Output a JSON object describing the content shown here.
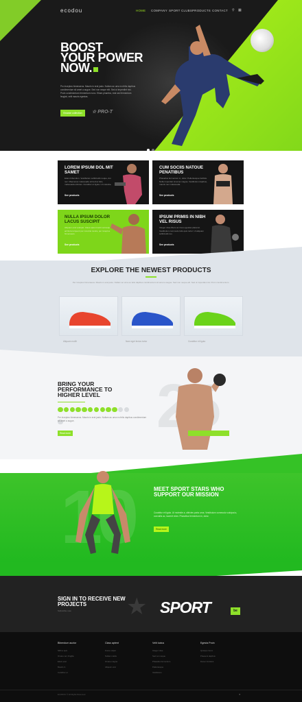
{
  "nav": {
    "logo": "ecodou",
    "items": [
      "HOME",
      "COMPANY",
      "SPORT CLUBS",
      "PRODUCTS",
      "CONTACT"
    ]
  },
  "hero": {
    "title_line1": "BOOST",
    "title_line2": "YOUR POWER",
    "title_line3": "NOW.",
    "text": "Pro inceptos himenaeos. Mauris in erat justo. Nullam ac urna eu felis dapibus condimentum sit amet a augue. Sed non neque elit. Sed ut imperdiet nisi. Proin condimentum fermentum nunc. Etiam pharetra, erat sed fermentum feugiat, velit mauris egestas.",
    "button": "Browse collection",
    "badge": "PRO-T"
  },
  "cards": [
    {
      "title": "LOREM IPSUM DOL MIT SAMET",
      "text": "Etiam bibendum. Vestibulum sollicitudin neque, dui nec. Maecenas malesuada elit lectus felis, malesuada ultricies. Curabitur et ligula. Ut molestie.",
      "link": "See products"
    },
    {
      "title": "CUM SOCIIS NATOUE PENATIBUS",
      "text": "Phasellus fermentum in, dolor. Pellentesque facilisis. Nulla imperdiet sit amet magna. Vestibulum dapibus, mauris nec malesuada.",
      "link": "See products"
    },
    {
      "title": "NULLA IPSUM DOLOR LACUS SUSCIPIT",
      "text": "Aliquam erat volutpat. Class aptent taciti sociosqu ad litora torquent per conubia nostra, per inceptos himenaeos.",
      "link": "See products"
    },
    {
      "title": "IPSUM PRIMIS IN NIBH VEL RISUS",
      "text": "Integer vitae libero ac risus egestas placerat. Vestibulum commodo felis quis tortor. Ut aliquam sollicitudin leo.",
      "link": "See products"
    }
  ],
  "products": {
    "title": "EXPLORE THE NEWEST PRODUCTS",
    "text": "Per inceptos himenaeos. Mauris in erat justo. Nullam ac urna eu felis dapibus condimentum sit amet a augue. Sed non neque elit. Sed ut imperdiet nisi. Proin condimentum.",
    "items": [
      {
        "label": "Aliquam mollit",
        "color": "#e8452e"
      },
      {
        "label": "Nam eget lectus tortor",
        "color": "#2a55c9"
      },
      {
        "label": "Curabitur et ligula",
        "color": "#6bd31a"
      }
    ]
  },
  "performance": {
    "title": "BRING YOUR PERFORMANCE TO HIGHER LEVEL",
    "text": "Per inceptos himenaeos. Mauris in erat justo. Nullam ac urna eu felis dapibus condimentum sit amet a augue.",
    "button": "Read more",
    "big_number": "25",
    "progress_filled": 10,
    "progress_total": 13
  },
  "stars": {
    "title": "MEET SPORT STARS WHO SUPPORT OUR MISSION",
    "text": "Curabitur et ligula. Ut molestie a, ultricies porta urna. Vestibulum commodo volutpat a, convallis ac, laoreet enim. Phasellus fermentum in, dolor.",
    "button": "Read more",
    "big_number": "10"
  },
  "signin": {
    "title": "SIGN IN TO RECEIVE NEW PROJECTS",
    "sub": "Subscribe now",
    "brand": "SPORT",
    "brand_suffix": "be"
  },
  "footer": {
    "columns": [
      {
        "title": "Bibendum auctor",
        "items": [
          "Nibh a quis",
          "Ornare vel, fringilla",
          "Etiam erat",
          "Mauris in",
          "Curabitur et"
        ]
      },
      {
        "title": "Class aptent",
        "items": [
          "Fusce vulput",
          "Nullam mattis",
          "Ornare magna",
          "Aliquam erat"
        ]
      },
      {
        "title": "Velit luctus",
        "items": [
          "Integer vitae",
          "Sed non neque",
          "Phasellus fermentum",
          "Pellentesque",
          "Vestibulum"
        ]
      },
      {
        "title": "Egesta Proin",
        "items": [
          "Quisque lorem",
          "Praesent dapibus",
          "Donec tincidunt"
        ]
      }
    ],
    "copyright": "ECODOU © All Rights Reserved."
  },
  "colors": {
    "accent": "#8ee02a",
    "dark": "#151515",
    "green": "#22b920"
  }
}
